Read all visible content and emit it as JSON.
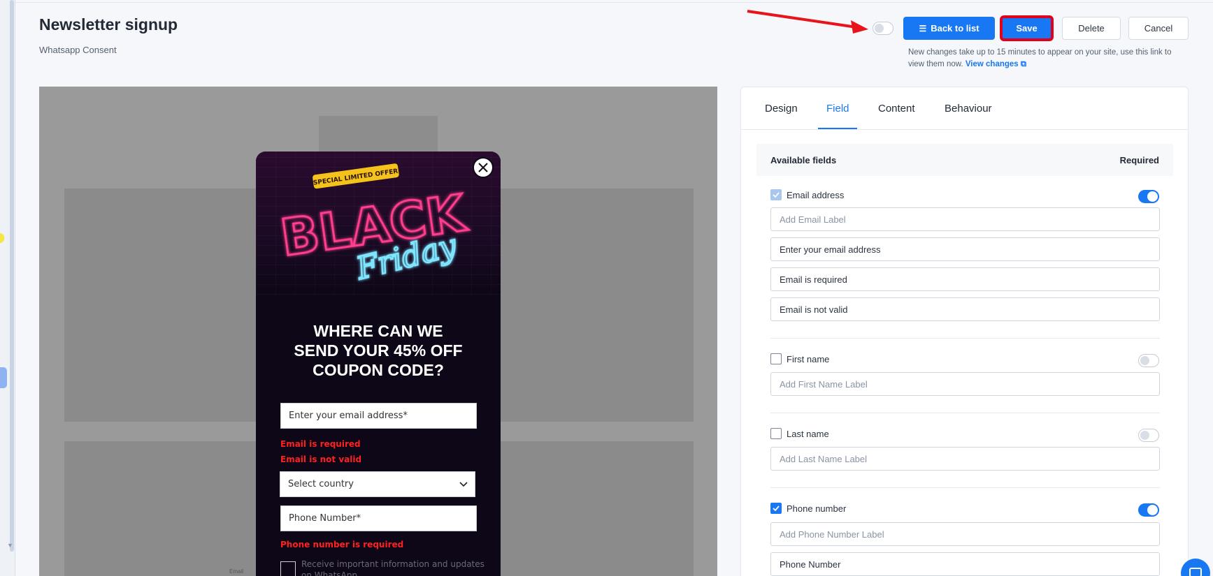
{
  "page": {
    "title": "Newsletter signup",
    "subtitle": "Whatsapp Consent"
  },
  "toolbar": {
    "back_label": "Back to list",
    "save_label": "Save",
    "delete_label": "Delete",
    "cancel_label": "Cancel",
    "notice": "New changes take up to 15 minutes to appear on your site, use this link to view them now.",
    "view_changes": "View changes"
  },
  "preview": {
    "heading_line1": "WHERE CAN WE",
    "heading_line2": "SEND YOUR 45% OFF",
    "heading_line3": "COUPON CODE?",
    "email_placeholder": "Enter your email address*",
    "email_required": "Email is required",
    "email_invalid": "Email is not valid",
    "country_placeholder": "Select country",
    "phone_placeholder": "Phone Number*",
    "phone_required": "Phone number is required",
    "consent_text": "Receive important information and updates on WhatsApp",
    "bg_email_label": "Email",
    "hero_badge": "SPECIAL LIMITED OFFER",
    "hero_title": "BLACK",
    "hero_script": "Friday"
  },
  "panel": {
    "tabs": [
      "Design",
      "Field",
      "Content",
      "Behaviour"
    ],
    "active_tab": "Field",
    "available_fields": "Available fields",
    "required": "Required",
    "email": {
      "label": "Email address",
      "label_placeholder": "Add Email Label",
      "placeholder_value": "Enter your email address",
      "required_msg": "Email is required",
      "invalid_msg": "Email is not valid"
    },
    "first_name": {
      "label": "First name",
      "label_placeholder": "Add First Name Label"
    },
    "last_name": {
      "label": "Last name",
      "label_placeholder": "Add Last Name Label"
    },
    "phone": {
      "label": "Phone number",
      "label_placeholder": "Add Phone Number Label",
      "placeholder_value": "Phone Number"
    }
  },
  "colors": {
    "accent": "#1877f2",
    "highlight": "#e0001a",
    "error": "#ff2020"
  }
}
